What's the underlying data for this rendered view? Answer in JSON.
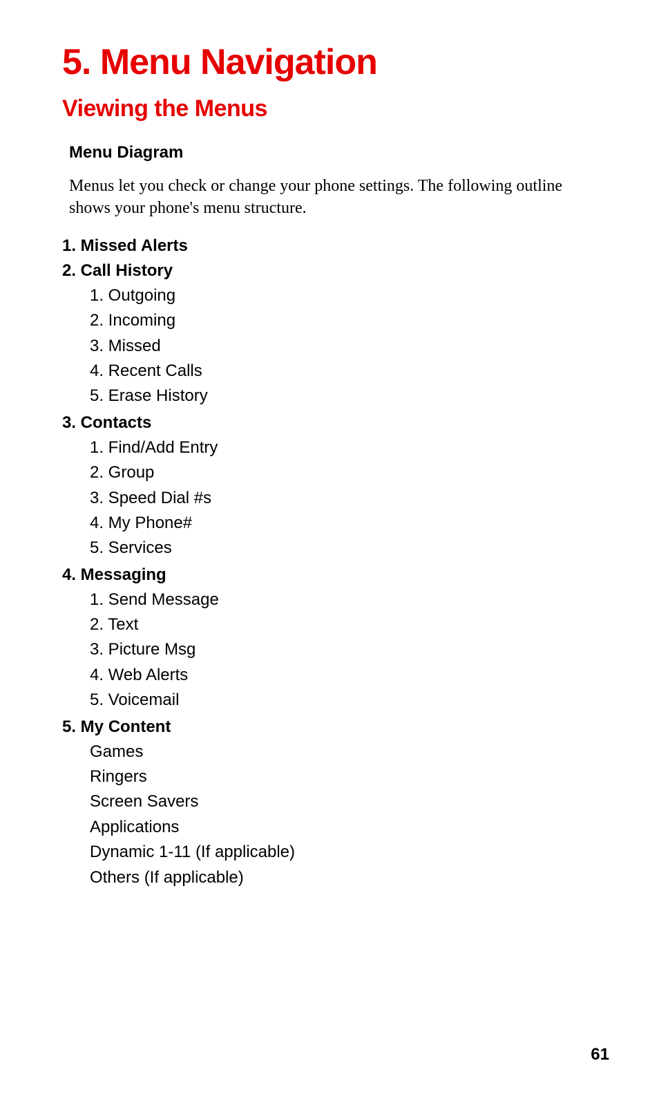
{
  "chapter_title": "5. Menu Navigation",
  "section_title": "Viewing the Menus",
  "sub_heading": "Menu Diagram",
  "body_text": "Menus let you check or change your phone settings. The following outline shows your phone's menu structure.",
  "menu": [
    {
      "label": "1. Missed Alerts",
      "items": []
    },
    {
      "label": "2. Call History",
      "items": [
        "1. Outgoing",
        "2. Incoming",
        "3. Missed",
        "4. Recent Calls",
        "5. Erase History"
      ]
    },
    {
      "label": "3. Contacts",
      "items": [
        "1. Find/Add Entry",
        "2. Group",
        "3. Speed Dial #s",
        "4. My Phone#",
        "5. Services"
      ]
    },
    {
      "label": "4. Messaging",
      "items": [
        "1. Send Message",
        "2. Text",
        "3. Picture Msg",
        "4. Web Alerts",
        "5. Voicemail"
      ]
    },
    {
      "label": "5. My Content",
      "items": [
        "Games",
        "Ringers",
        "Screen Savers",
        "Applications",
        "Dynamic 1-11 (If applicable)",
        "Others (If applicable)"
      ]
    }
  ],
  "page_number": "61"
}
